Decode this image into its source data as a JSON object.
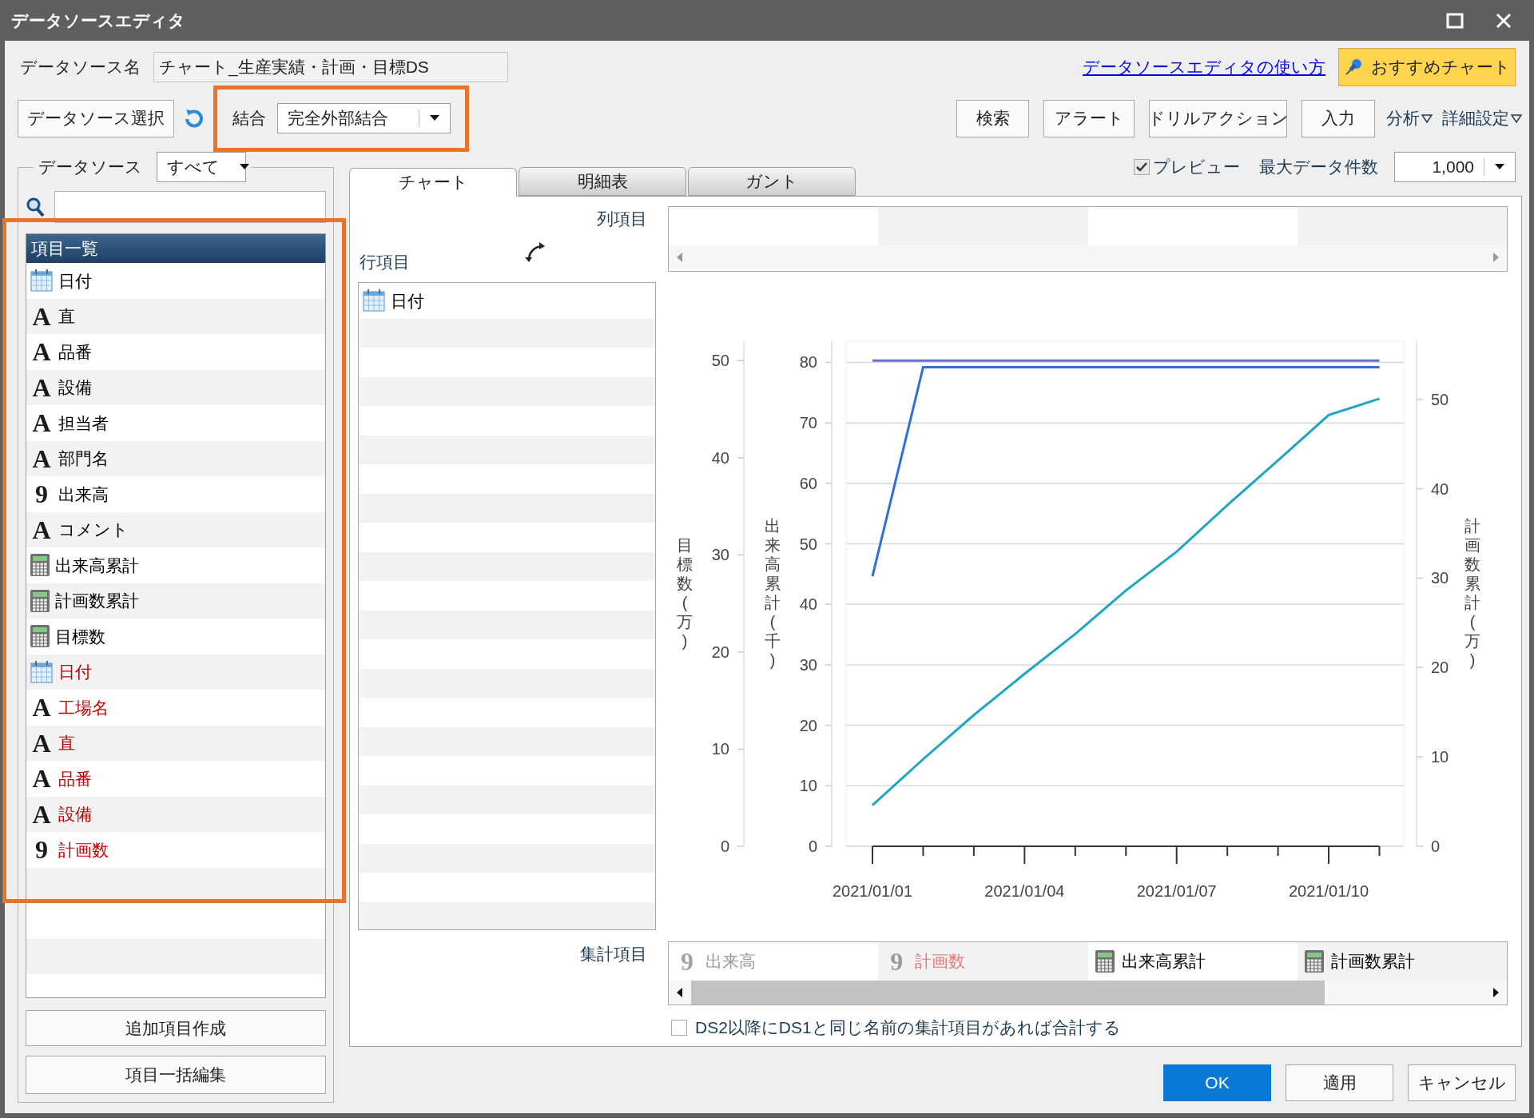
{
  "window": {
    "title": "データソースエディタ"
  },
  "datasource_name": {
    "label": "データソース名",
    "value": "チャート_生産実績・計画・目標DS"
  },
  "help_link": "データソースエディタの使い方",
  "recommend_button": "おすすめチャート",
  "select_button": "データソース選択",
  "join": {
    "label": "結合",
    "value": "完全外部結合"
  },
  "toolbar_buttons": [
    "検索",
    "アラート",
    "ドリルアクション",
    "入力"
  ],
  "menus": [
    "分析",
    "詳細設定"
  ],
  "datasource_filter": {
    "label": "データソース",
    "value": "すべて"
  },
  "item_list": {
    "header": "項目一覧",
    "items": [
      {
        "kind": "date",
        "label": "日付",
        "color": "#000000"
      },
      {
        "kind": "glyph",
        "glyph": "A",
        "label": "直",
        "color": "#000000"
      },
      {
        "kind": "glyph",
        "glyph": "A",
        "label": "品番",
        "color": "#000000"
      },
      {
        "kind": "glyph",
        "glyph": "A",
        "label": "設備",
        "color": "#000000"
      },
      {
        "kind": "glyph",
        "glyph": "A",
        "label": "担当者",
        "color": "#000000"
      },
      {
        "kind": "glyph",
        "glyph": "A",
        "label": "部門名",
        "color": "#000000"
      },
      {
        "kind": "glyph",
        "glyph": "9",
        "label": "出来高",
        "color": "#000000"
      },
      {
        "kind": "glyph",
        "glyph": "A",
        "label": "コメント",
        "color": "#000000"
      },
      {
        "kind": "calc",
        "label": "出来高累計",
        "color": "#000000"
      },
      {
        "kind": "calc",
        "label": "計画数累計",
        "color": "#000000"
      },
      {
        "kind": "calc",
        "label": "目標数",
        "color": "#000000"
      },
      {
        "kind": "date",
        "label": "日付",
        "color": "#c00000"
      },
      {
        "kind": "glyph",
        "glyph": "A",
        "label": "工場名",
        "color": "#c00000"
      },
      {
        "kind": "glyph",
        "glyph": "A",
        "label": "直",
        "color": "#c00000"
      },
      {
        "kind": "glyph",
        "glyph": "A",
        "label": "品番",
        "color": "#c00000"
      },
      {
        "kind": "glyph",
        "glyph": "A",
        "label": "設備",
        "color": "#c00000"
      },
      {
        "kind": "glyph",
        "glyph": "9",
        "label": "計画数",
        "color": "#c00000"
      }
    ]
  },
  "add_item_button": "追加項目作成",
  "bulk_edit_button": "項目一括編集",
  "preview": {
    "label": "プレビュー",
    "checked": true
  },
  "max_rows": {
    "label": "最大データ件数",
    "value": "1,000"
  },
  "tabs": [
    {
      "label": "チャート",
      "selected": true
    },
    {
      "label": "明細表",
      "selected": false
    },
    {
      "label": "ガント",
      "selected": false
    }
  ],
  "column_items_label": "列項目",
  "row_items_label": "行項目",
  "row_items": [
    {
      "kind": "date",
      "label": "日付",
      "color": "#000000"
    }
  ],
  "chart_data": {
    "type": "line",
    "categories": [
      "2021/01/01",
      null,
      null,
      "2021/01/04",
      null,
      null,
      "2021/01/07",
      null,
      null,
      "2021/01/10",
      null
    ],
    "ylabel": "出来高累計(千)",
    "ylim": [
      0,
      83.5
    ],
    "yticks": [
      0,
      10,
      20,
      30,
      40,
      50,
      60,
      70,
      80
    ],
    "grid": true,
    "y2label": "計画数累計(万)",
    "y2lim": [
      0,
      56.5
    ],
    "y2ticks": [
      0,
      10,
      20,
      30,
      40,
      50
    ],
    "y3label": "目標数(万)",
    "y3lim": [
      0,
      52
    ],
    "y3ticks": [
      0,
      10,
      20,
      30,
      40,
      50
    ],
    "series": [
      {
        "color": "#6b6bd6",
        "axis": "y3",
        "values": [
          50,
          50,
          50,
          50,
          50,
          50,
          50,
          50,
          50,
          50,
          50
        ]
      },
      {
        "color": "#2f6fdc",
        "axis": "y2",
        "values": [
          30.2,
          53.6,
          53.6,
          53.6,
          53.6,
          53.6,
          53.6,
          53.6,
          53.6,
          53.6,
          53.6
        ]
      },
      {
        "color": "#1ea5c2",
        "values": [
          6.8,
          14.4,
          21.7,
          28.5,
          35.1,
          42.3,
          48.7,
          56.4,
          63.8,
          71.3,
          74.0
        ]
      }
    ]
  },
  "aggregate_label": "集計項目",
  "aggregate_items": [
    {
      "kind": "glyph",
      "glyph": "9",
      "label": "出来高",
      "color": "#9a9a9a",
      "disabled": true
    },
    {
      "kind": "glyph",
      "glyph": "9",
      "label": "計画数",
      "color": "#e07c7c",
      "disabled": true
    },
    {
      "kind": "calc",
      "label": "出来高累計",
      "color": "#000000",
      "disabled": false
    },
    {
      "kind": "calc",
      "label": "計画数累計",
      "color": "#000000",
      "disabled": false
    }
  ],
  "sum_option": {
    "label": "DS2以降にDS1と同じ名前の集計項目があれば合計する",
    "checked": false
  },
  "dialog_buttons": [
    {
      "label": "OK",
      "primary": true
    },
    {
      "label": "適用",
      "primary": false
    },
    {
      "label": "キャンセル",
      "primary": false
    }
  ]
}
